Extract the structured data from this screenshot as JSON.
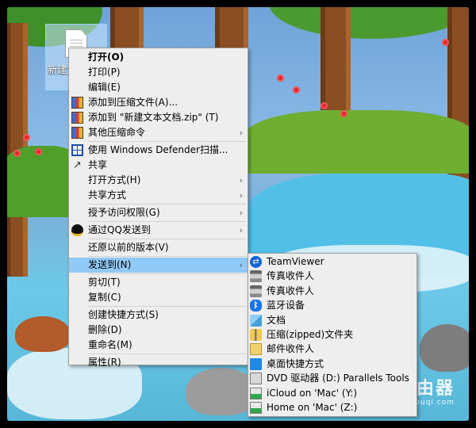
{
  "desktop": {
    "file_icon_label": "新建文本文档.txt"
  },
  "context_menu": {
    "items": [
      {
        "label": "打开(O)",
        "icon": "",
        "bold": true
      },
      {
        "label": "打印(P)",
        "icon": ""
      },
      {
        "label": "编辑(E)",
        "icon": ""
      },
      {
        "label": "添加到压缩文件(A)...",
        "icon": "winrar-icon"
      },
      {
        "label": "添加到 \"新建文本文档.zip\" (T)",
        "icon": "winrar-icon"
      },
      {
        "label": "其他压缩命令",
        "icon": "winrar-icon",
        "submenu": true
      },
      {
        "label": "使用 Windows Defender扫描...",
        "icon": "windows-defender-icon"
      },
      {
        "label": "共享",
        "icon": "share-icon"
      },
      {
        "label": "打开方式(H)",
        "icon": "",
        "submenu": true
      },
      {
        "label": "共享方式",
        "icon": "",
        "submenu": true
      },
      {
        "label": "授予访问权限(G)",
        "icon": "",
        "submenu": true
      },
      {
        "label": "通过QQ发送到",
        "icon": "qq-icon",
        "submenu": true
      },
      {
        "label": "还原以前的版本(V)",
        "icon": ""
      },
      {
        "label": "发送到(N)",
        "icon": "",
        "submenu": true,
        "highlighted": true
      },
      {
        "label": "剪切(T)",
        "icon": ""
      },
      {
        "label": "复制(C)",
        "icon": ""
      },
      {
        "label": "创建快捷方式(S)",
        "icon": ""
      },
      {
        "label": "删除(D)",
        "icon": ""
      },
      {
        "label": "重命名(M)",
        "icon": ""
      },
      {
        "label": "属性(R)",
        "icon": ""
      }
    ],
    "submenu_arrow": "›"
  },
  "sendto_menu": {
    "items": [
      {
        "label": "TeamViewer",
        "icon": "teamviewer-icon"
      },
      {
        "label": "传真收件人",
        "icon": "fax-icon"
      },
      {
        "label": "传真收件人",
        "icon": "fax-icon"
      },
      {
        "label": "蓝牙设备",
        "icon": "bluetooth-icon"
      },
      {
        "label": "文档",
        "icon": "documents-icon"
      },
      {
        "label": "压缩(zipped)文件夹",
        "icon": "zip-folder-icon"
      },
      {
        "label": "邮件收件人",
        "icon": "mail-icon"
      },
      {
        "label": "桌面快捷方式",
        "icon": "desktop-icon"
      },
      {
        "label": "DVD 驱动器 (D:) Parallels Tools",
        "icon": "dvd-drive-icon"
      },
      {
        "label": "iCloud on 'Mac' (Y:)",
        "icon": "network-drive-icon"
      },
      {
        "label": "Home on 'Mac' (Z:)",
        "icon": "network-drive-icon"
      }
    ]
  },
  "watermark": {
    "text": "路由器",
    "sub": "luyouqi.com"
  },
  "colors": {
    "menu_background": "#eeeeee",
    "highlight": "#91c9f7"
  }
}
